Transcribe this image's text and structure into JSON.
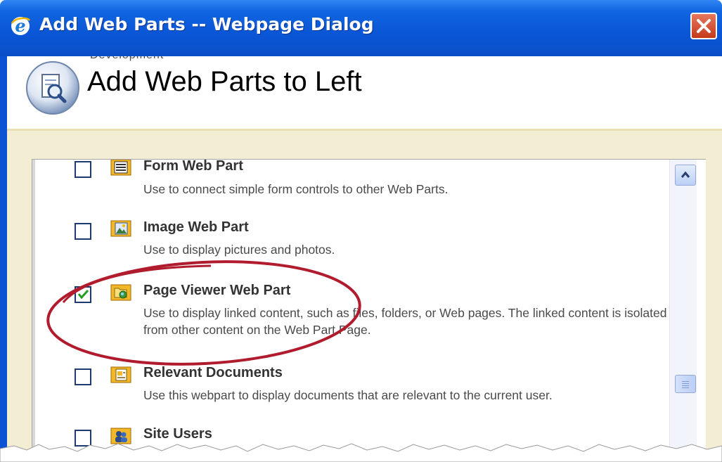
{
  "window": {
    "title": "Add Web Parts -- Webpage Dialog"
  },
  "header": {
    "breadcrumb": "Development",
    "title": "Add Web Parts to Left"
  },
  "web_parts": [
    {
      "title": "Form Web Part",
      "description": "Use to connect simple form controls to other Web Parts.",
      "checked": false,
      "icon": "form-icon"
    },
    {
      "title": "Image Web Part",
      "description": "Use to display pictures and photos.",
      "checked": false,
      "icon": "image-icon"
    },
    {
      "title": "Page Viewer Web Part",
      "description": "Use to display linked content, such as files, folders, or Web pages. The linked content is isolated from other content on the Web Part Page.",
      "checked": true,
      "icon": "page-viewer-icon"
    },
    {
      "title": "Relevant Documents",
      "description": "Use this webpart to display documents that are relevant to the current user.",
      "checked": false,
      "icon": "documents-icon"
    },
    {
      "title": "Site Users",
      "description": "",
      "checked": false,
      "icon": "users-icon"
    }
  ],
  "colors": {
    "titlebar": "#0a56d6",
    "annotation": "#b01c2e",
    "panel_background": "#f2edd3"
  }
}
